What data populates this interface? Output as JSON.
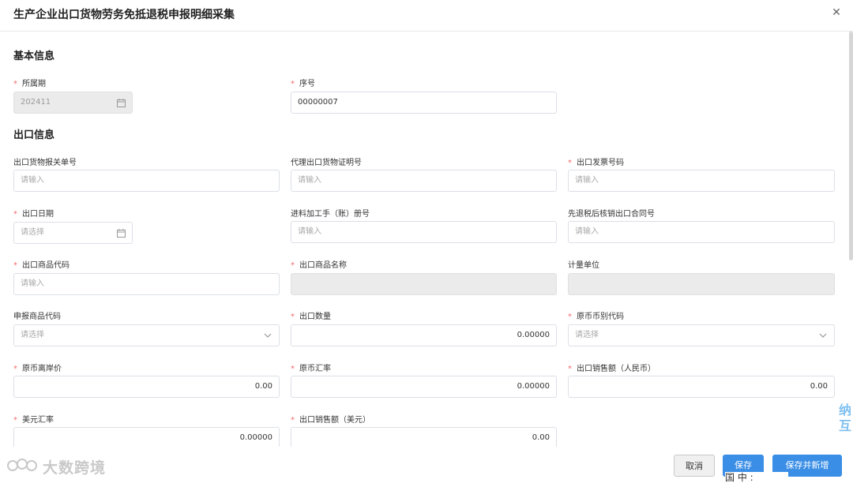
{
  "dialog": {
    "title": "生产企业出口货物劳务免抵退税申报明细采集",
    "close_icon": "close-icon"
  },
  "sections": {
    "basic": "基本信息",
    "export": "出口信息"
  },
  "fields": {
    "period": {
      "label": "所属期",
      "value": "202411",
      "required": true
    },
    "seq": {
      "label": "序号",
      "value": "00000007",
      "required": true
    },
    "customs_decl": {
      "label": "出口货物报关单号",
      "placeholder": "请输入",
      "required": false
    },
    "agent_cert": {
      "label": "代理出口货物证明号",
      "placeholder": "请输入",
      "required": false
    },
    "invoice_no": {
      "label": "出口发票号码",
      "placeholder": "请输入",
      "required": true
    },
    "export_date": {
      "label": "出口日期",
      "placeholder": "请选择",
      "required": true
    },
    "processing_book": {
      "label": "进料加工手（账）册号",
      "placeholder": "请输入",
      "required": false
    },
    "contract_no": {
      "label": "先退税后核销出口合同号",
      "placeholder": "请输入",
      "required": false
    },
    "goods_code": {
      "label": "出口商品代码",
      "placeholder": "请输入",
      "required": true
    },
    "goods_name": {
      "label": "出口商品名称",
      "value": "",
      "required": true
    },
    "unit": {
      "label": "计量单位",
      "value": "",
      "required": false
    },
    "decl_goods_code": {
      "label": "申报商品代码",
      "placeholder": "请选择",
      "required": false
    },
    "quantity": {
      "label": "出口数量",
      "value": "0.00000",
      "required": true
    },
    "currency_code": {
      "label": "原币币别代码",
      "placeholder": "请选择",
      "required": true
    },
    "fob_price": {
      "label": "原币离岸价",
      "value": "0.00",
      "required": true
    },
    "fx_rate": {
      "label": "原币汇率",
      "value": "0.00000",
      "required": true
    },
    "sales_rmb": {
      "label": "出口销售额（人民币）",
      "value": "0.00",
      "required": true
    },
    "usd_rate": {
      "label": "美元汇率",
      "value": "0.00000",
      "required": true
    },
    "sales_usd": {
      "label": "出口销售额（美元）",
      "value": "0.00",
      "required": true
    }
  },
  "footer": {
    "cancel": "取消",
    "save": "保存",
    "save_new": "保存并新增"
  },
  "watermark": "大数跨境",
  "ime": "国 中 :",
  "edge_text": "纳 互",
  "colors": {
    "primary": "#3a8ee6",
    "required": "#f56c6c",
    "disabled_bg": "#ebebeb"
  }
}
